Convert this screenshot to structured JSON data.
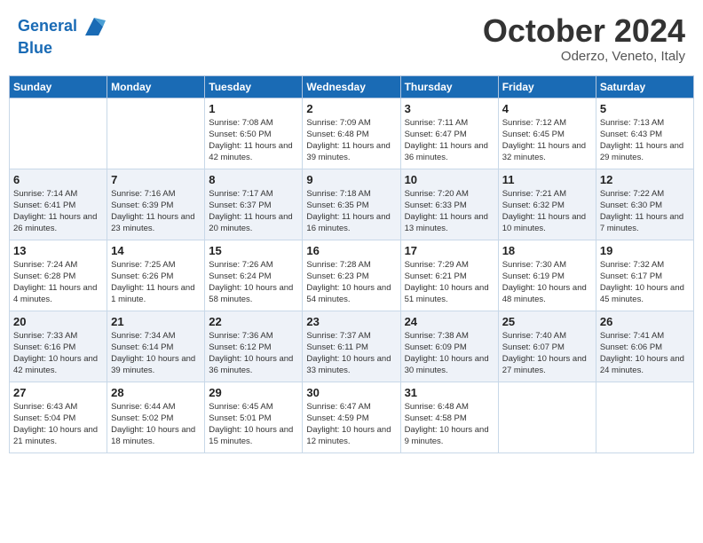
{
  "header": {
    "logo_line1": "General",
    "logo_line2": "Blue",
    "month": "October 2024",
    "location": "Oderzo, Veneto, Italy"
  },
  "days_of_week": [
    "Sunday",
    "Monday",
    "Tuesday",
    "Wednesday",
    "Thursday",
    "Friday",
    "Saturday"
  ],
  "weeks": [
    [
      {
        "day": "",
        "sunrise": "",
        "sunset": "",
        "daylight": ""
      },
      {
        "day": "",
        "sunrise": "",
        "sunset": "",
        "daylight": ""
      },
      {
        "day": "1",
        "sunrise": "Sunrise: 7:08 AM",
        "sunset": "Sunset: 6:50 PM",
        "daylight": "Daylight: 11 hours and 42 minutes."
      },
      {
        "day": "2",
        "sunrise": "Sunrise: 7:09 AM",
        "sunset": "Sunset: 6:48 PM",
        "daylight": "Daylight: 11 hours and 39 minutes."
      },
      {
        "day": "3",
        "sunrise": "Sunrise: 7:11 AM",
        "sunset": "Sunset: 6:47 PM",
        "daylight": "Daylight: 11 hours and 36 minutes."
      },
      {
        "day": "4",
        "sunrise": "Sunrise: 7:12 AM",
        "sunset": "Sunset: 6:45 PM",
        "daylight": "Daylight: 11 hours and 32 minutes."
      },
      {
        "day": "5",
        "sunrise": "Sunrise: 7:13 AM",
        "sunset": "Sunset: 6:43 PM",
        "daylight": "Daylight: 11 hours and 29 minutes."
      }
    ],
    [
      {
        "day": "6",
        "sunrise": "Sunrise: 7:14 AM",
        "sunset": "Sunset: 6:41 PM",
        "daylight": "Daylight: 11 hours and 26 minutes."
      },
      {
        "day": "7",
        "sunrise": "Sunrise: 7:16 AM",
        "sunset": "Sunset: 6:39 PM",
        "daylight": "Daylight: 11 hours and 23 minutes."
      },
      {
        "day": "8",
        "sunrise": "Sunrise: 7:17 AM",
        "sunset": "Sunset: 6:37 PM",
        "daylight": "Daylight: 11 hours and 20 minutes."
      },
      {
        "day": "9",
        "sunrise": "Sunrise: 7:18 AM",
        "sunset": "Sunset: 6:35 PM",
        "daylight": "Daylight: 11 hours and 16 minutes."
      },
      {
        "day": "10",
        "sunrise": "Sunrise: 7:20 AM",
        "sunset": "Sunset: 6:33 PM",
        "daylight": "Daylight: 11 hours and 13 minutes."
      },
      {
        "day": "11",
        "sunrise": "Sunrise: 7:21 AM",
        "sunset": "Sunset: 6:32 PM",
        "daylight": "Daylight: 11 hours and 10 minutes."
      },
      {
        "day": "12",
        "sunrise": "Sunrise: 7:22 AM",
        "sunset": "Sunset: 6:30 PM",
        "daylight": "Daylight: 11 hours and 7 minutes."
      }
    ],
    [
      {
        "day": "13",
        "sunrise": "Sunrise: 7:24 AM",
        "sunset": "Sunset: 6:28 PM",
        "daylight": "Daylight: 11 hours and 4 minutes."
      },
      {
        "day": "14",
        "sunrise": "Sunrise: 7:25 AM",
        "sunset": "Sunset: 6:26 PM",
        "daylight": "Daylight: 11 hours and 1 minute."
      },
      {
        "day": "15",
        "sunrise": "Sunrise: 7:26 AM",
        "sunset": "Sunset: 6:24 PM",
        "daylight": "Daylight: 10 hours and 58 minutes."
      },
      {
        "day": "16",
        "sunrise": "Sunrise: 7:28 AM",
        "sunset": "Sunset: 6:23 PM",
        "daylight": "Daylight: 10 hours and 54 minutes."
      },
      {
        "day": "17",
        "sunrise": "Sunrise: 7:29 AM",
        "sunset": "Sunset: 6:21 PM",
        "daylight": "Daylight: 10 hours and 51 minutes."
      },
      {
        "day": "18",
        "sunrise": "Sunrise: 7:30 AM",
        "sunset": "Sunset: 6:19 PM",
        "daylight": "Daylight: 10 hours and 48 minutes."
      },
      {
        "day": "19",
        "sunrise": "Sunrise: 7:32 AM",
        "sunset": "Sunset: 6:17 PM",
        "daylight": "Daylight: 10 hours and 45 minutes."
      }
    ],
    [
      {
        "day": "20",
        "sunrise": "Sunrise: 7:33 AM",
        "sunset": "Sunset: 6:16 PM",
        "daylight": "Daylight: 10 hours and 42 minutes."
      },
      {
        "day": "21",
        "sunrise": "Sunrise: 7:34 AM",
        "sunset": "Sunset: 6:14 PM",
        "daylight": "Daylight: 10 hours and 39 minutes."
      },
      {
        "day": "22",
        "sunrise": "Sunrise: 7:36 AM",
        "sunset": "Sunset: 6:12 PM",
        "daylight": "Daylight: 10 hours and 36 minutes."
      },
      {
        "day": "23",
        "sunrise": "Sunrise: 7:37 AM",
        "sunset": "Sunset: 6:11 PM",
        "daylight": "Daylight: 10 hours and 33 minutes."
      },
      {
        "day": "24",
        "sunrise": "Sunrise: 7:38 AM",
        "sunset": "Sunset: 6:09 PM",
        "daylight": "Daylight: 10 hours and 30 minutes."
      },
      {
        "day": "25",
        "sunrise": "Sunrise: 7:40 AM",
        "sunset": "Sunset: 6:07 PM",
        "daylight": "Daylight: 10 hours and 27 minutes."
      },
      {
        "day": "26",
        "sunrise": "Sunrise: 7:41 AM",
        "sunset": "Sunset: 6:06 PM",
        "daylight": "Daylight: 10 hours and 24 minutes."
      }
    ],
    [
      {
        "day": "27",
        "sunrise": "Sunrise: 6:43 AM",
        "sunset": "Sunset: 5:04 PM",
        "daylight": "Daylight: 10 hours and 21 minutes."
      },
      {
        "day": "28",
        "sunrise": "Sunrise: 6:44 AM",
        "sunset": "Sunset: 5:02 PM",
        "daylight": "Daylight: 10 hours and 18 minutes."
      },
      {
        "day": "29",
        "sunrise": "Sunrise: 6:45 AM",
        "sunset": "Sunset: 5:01 PM",
        "daylight": "Daylight: 10 hours and 15 minutes."
      },
      {
        "day": "30",
        "sunrise": "Sunrise: 6:47 AM",
        "sunset": "Sunset: 4:59 PM",
        "daylight": "Daylight: 10 hours and 12 minutes."
      },
      {
        "day": "31",
        "sunrise": "Sunrise: 6:48 AM",
        "sunset": "Sunset: 4:58 PM",
        "daylight": "Daylight: 10 hours and 9 minutes."
      },
      {
        "day": "",
        "sunrise": "",
        "sunset": "",
        "daylight": ""
      },
      {
        "day": "",
        "sunrise": "",
        "sunset": "",
        "daylight": ""
      }
    ]
  ]
}
